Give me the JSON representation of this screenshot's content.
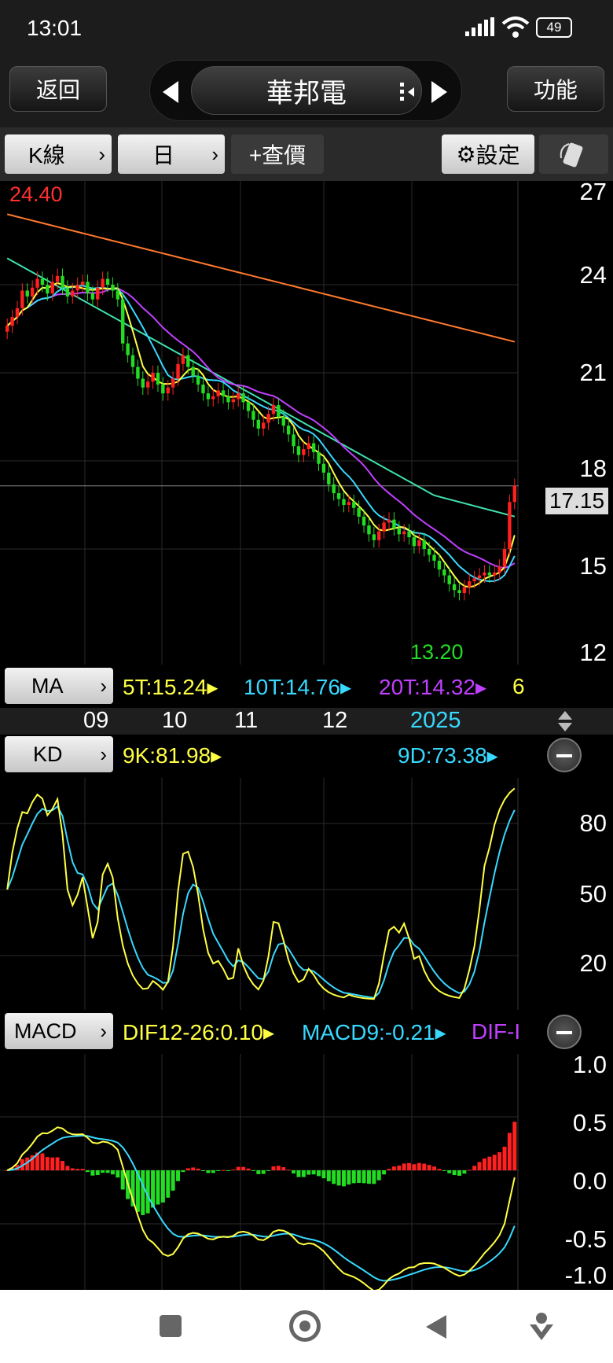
{
  "status": {
    "time": "13:01",
    "battery": "49"
  },
  "nav": {
    "back": "返回",
    "title": "華邦電",
    "function": "功能"
  },
  "toolbar": {
    "kline": "K線",
    "period": "日",
    "query": "+查價",
    "settings": "設定"
  },
  "price_pane": {
    "y_ticks": [
      "27",
      "24",
      "21",
      "18",
      "15",
      "12"
    ],
    "current_price": "17.15",
    "high_label": "24.40",
    "low_label": "13.20"
  },
  "ma_bar": {
    "label": "MA",
    "ma5": "5T:15.24",
    "ma10": "10T:14.76",
    "ma20": "20T:14.32",
    "more": "6"
  },
  "x_axis": {
    "ticks": [
      "09",
      "10",
      "11",
      "12",
      "2025"
    ]
  },
  "kd_bar": {
    "label": "KD",
    "k": "9K:81.98",
    "d": "9D:73.38"
  },
  "kd_pane": {
    "y_ticks": [
      "80",
      "50",
      "20"
    ]
  },
  "macd_bar": {
    "label": "MACD",
    "dif": "DIF12-26:0.10",
    "macd": "MACD9:-0.21",
    "osc": "DIF-I"
  },
  "macd_pane": {
    "y_ticks": [
      "1.0",
      "0.5",
      "0.0",
      "-0.5",
      "-1.0"
    ]
  },
  "colors": {
    "up": "#ff2020",
    "down": "#22dd22",
    "ma5": "#ffff44",
    "ma10": "#38d8ff",
    "ma20": "#c040ff",
    "ma60": "#40e0b0",
    "ma240": "#ff7a30"
  },
  "chart_data": {
    "type": "candlestick",
    "series_labels": [
      "5T",
      "10T",
      "20T"
    ],
    "closes": [
      22.6,
      22.9,
      23.2,
      23.8,
      23.6,
      23.9,
      24.2,
      24.0,
      23.7,
      24.1,
      24.3,
      23.9,
      23.6,
      23.8,
      24.0,
      24.1,
      23.7,
      23.5,
      23.9,
      24.2,
      24.0,
      23.8,
      23.5,
      22.0,
      21.6,
      21.2,
      20.8,
      20.5,
      20.7,
      21.0,
      20.6,
      20.3,
      20.5,
      20.8,
      21.3,
      21.6,
      21.2,
      20.9,
      20.6,
      20.3,
      20.1,
      20.2,
      20.4,
      20.2,
      20.0,
      20.1,
      20.3,
      20.0,
      19.7,
      19.4,
      19.1,
      19.3,
      19.6,
      19.9,
      19.5,
      19.2,
      18.9,
      18.5,
      18.2,
      18.4,
      18.6,
      18.3,
      17.9,
      17.6,
      17.2,
      16.9,
      16.7,
      16.5,
      16.6,
      16.4,
      16.1,
      15.8,
      15.5,
      15.3,
      15.6,
      15.9,
      16.0,
      15.7,
      15.5,
      15.6,
      15.4,
      15.1,
      15.3,
      15.0,
      14.8,
      14.6,
      14.3,
      14.1,
      13.8,
      13.6,
      13.5,
      13.7,
      13.9,
      14.0,
      14.1,
      14.2,
      14.1,
      14.2,
      14.4,
      15.0,
      16.6,
      17.15
    ]
  }
}
